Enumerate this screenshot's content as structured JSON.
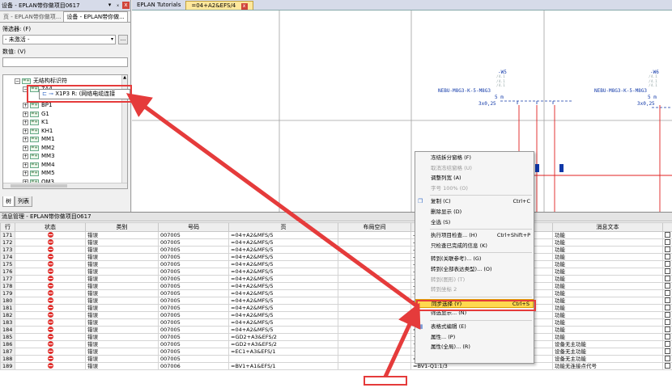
{
  "left_panel": {
    "title": "设备 - EPLAN带你做项目0617",
    "pin": "▾",
    "pin2": "ₓ",
    "close": "x",
    "tabs": [
      "页 - EPLAN带你做项...",
      "设备 - EPLAN带你做..."
    ],
    "filter_label": "筛选器: (F)",
    "filter_value": "- 未激活 -",
    "filter_button": "...",
    "value_label": "数值: (V)",
    "tree": {
      "root": "无结构标识符",
      "items": [
        "7A4",
        "X1P3 R: (网络电缆连接",
        "BP1",
        "G1",
        "K1",
        "KH1",
        "MM1",
        "MM2",
        "MM3",
        "MM4",
        "MM5",
        "QM3"
      ]
    },
    "bottom_tabs": [
      "树",
      "列表"
    ]
  },
  "editor": {
    "tabs": [
      {
        "label": "EPLAN Tutorials"
      },
      {
        "label": "=04+A2&EFS/4",
        "close": "x"
      }
    ],
    "cad_labels": [
      {
        "ref": "-W5",
        "refs": [
          "/4.1",
          "/4.1",
          "/4.1"
        ],
        "type": "NEBU-M8G3-K-5-M8G3",
        "length": "5 m",
        "section": "3x0,25"
      },
      {
        "ref": "-W6",
        "refs": [
          "/4.1",
          "/4.1",
          "/4.1"
        ],
        "type": "NEBU-M8G3-K-5-M8G3",
        "length": "5 m",
        "section": "3x0,25"
      }
    ]
  },
  "messages": {
    "title": "消息管理 - EPLAN带你做项目0617",
    "columns": [
      "行",
      "状态",
      "类别",
      "号码",
      "页",
      "布局空间",
      "",
      "消息文本",
      ""
    ],
    "rows": [
      {
        "row": "171",
        "category": "错误",
        "code": "007005",
        "page": "=04+A2&MFS/5",
        "target": "-QM9-QM2:3",
        "text": "功能"
      },
      {
        "row": "172",
        "category": "错误",
        "code": "007005",
        "page": "=04+A2&MFS/5",
        "target": "-QM9-QM2:1",
        "text": "功能"
      },
      {
        "row": "173",
        "category": "错误",
        "code": "007005",
        "page": "=04+A2&MFS/5",
        "target": "-QM9-QM2:14",
        "text": "功能"
      },
      {
        "row": "174",
        "category": "错误",
        "code": "007005",
        "page": "=04+A2&MFS/5",
        "target": "-XL7-XL1:5",
        "text": "功能"
      },
      {
        "row": "175",
        "category": "错误",
        "code": "007005",
        "page": "=04+A2&MFS/5",
        "target": "-XL7-XL1:3",
        "text": "功能"
      },
      {
        "row": "176",
        "category": "错误",
        "code": "007005",
        "page": "=04+A2&MFS/5",
        "target": "-XL7-XL1:12",
        "text": "功能"
      },
      {
        "row": "177",
        "category": "错误",
        "code": "007005",
        "page": "=04+A2&MFS/5",
        "target": "-XL7-XL1:1",
        "text": "功能"
      },
      {
        "row": "178",
        "category": "错误",
        "code": "007005",
        "page": "=04+A2&MFS/5",
        "target": "-XL7-XL1:1",
        "text": "功能"
      },
      {
        "row": "179",
        "category": "错误",
        "code": "007005",
        "page": "=04+A2&MFS/5",
        "target": "-XL7-XL1:5",
        "text": "功能"
      },
      {
        "row": "180",
        "category": "错误",
        "code": "007005",
        "page": "=04+A2&MFS/5",
        "target": "-XL7-XL1:3",
        "text": "功能"
      },
      {
        "row": "181",
        "category": "错误",
        "code": "007005",
        "page": "=04+A2&MFS/5",
        "target": "-XL7-XL1:12",
        "text": "功能"
      },
      {
        "row": "182",
        "category": "错误",
        "code": "007005",
        "page": "=04+A2&MFS/5",
        "target": "-XL7-XL1:14",
        "text": "功能"
      },
      {
        "row": "183",
        "category": "错误",
        "code": "007005",
        "page": "=04+A2&MFS/5",
        "target": "=04+A2-MM5-B",
        "text": "功能"
      },
      {
        "row": "184",
        "category": "错误",
        "code": "007005",
        "page": "=04+A2&MFS/5",
        "target": "=04+A2-MM5-B2",
        "text": "功能"
      },
      {
        "row": "185",
        "category": "错误",
        "code": "007005",
        "page": "=GD2+A3&EFS/2",
        "target": "+A3-WE1",
        "text": "功能"
      },
      {
        "row": "186",
        "category": "错误",
        "code": "007005",
        "page": "=GD2+A3&EFS/2",
        "target": "+A3-WE1",
        "text": "设备无主功能"
      },
      {
        "row": "187",
        "category": "错误",
        "code": "007005",
        "page": "=EC1+A3&EFS/1",
        "target": "+A3-WE1",
        "text": "设备无主功能"
      },
      {
        "row": "188",
        "category": "错误",
        "code": "007005",
        "page": "",
        "target": "=+-7A4",
        "text": "设备无主功能"
      },
      {
        "row": "189",
        "category": "错误",
        "code": "007006",
        "page": "=BV1+A1&EFS/1",
        "target": "=BV1-Q1:1/3",
        "text": "功能无连接点代号"
      }
    ]
  },
  "context_menu": {
    "items": [
      {
        "label": "冻结拆分窗格 (F)",
        "shortcut": "",
        "disabled": false
      },
      {
        "label": "取消冻结窗格 (U)",
        "shortcut": "",
        "disabled": true
      },
      {
        "label": "调整列宽 (A)",
        "shortcut": "",
        "disabled": false
      },
      {
        "label": "字号 100% (O)",
        "shortcut": "",
        "disabled": true
      },
      {
        "label": "复制 (C)",
        "shortcut": "Ctrl+C",
        "disabled": false,
        "icon": "copy-icon"
      },
      {
        "label": "删除显示 (D)",
        "shortcut": "",
        "disabled": false
      },
      {
        "label": "全选 (S)",
        "shortcut": "",
        "disabled": false
      },
      {
        "label": "执行项目检查... (H)",
        "shortcut": "Ctrl+Shift+P",
        "disabled": false
      },
      {
        "label": "只检查已完成的信息 (K)",
        "shortcut": "",
        "disabled": false
      },
      {
        "label": "转到(关联参考)... (G)",
        "shortcut": "",
        "disabled": false
      },
      {
        "label": "转到(全部表达类型)... (O)",
        "shortcut": "",
        "disabled": false
      },
      {
        "label": "转到(图形) (T)",
        "shortcut": "",
        "disabled": true
      },
      {
        "label": "转到坐标 2",
        "shortcut": "",
        "disabled": true
      },
      {
        "label": "同步选择 (Y)",
        "shortcut": "Ctrl+S",
        "disabled": false,
        "highlight": true
      },
      {
        "label": "筛选显示... (N)",
        "shortcut": "",
        "disabled": false
      },
      {
        "label": "表格式编辑 (E)",
        "shortcut": "",
        "disabled": false,
        "icon": "table-icon"
      },
      {
        "label": "属性... (P)",
        "shortcut": "",
        "disabled": false
      },
      {
        "label": "属性(全局)... (R)",
        "shortcut": "",
        "disabled": false
      }
    ]
  },
  "colors": {
    "highlight": "#ffd84f",
    "annotation_red": "#e53b3b",
    "error_red": "#e0312e",
    "cad_blue": "#1038a8",
    "cad_red": "#e02020"
  }
}
